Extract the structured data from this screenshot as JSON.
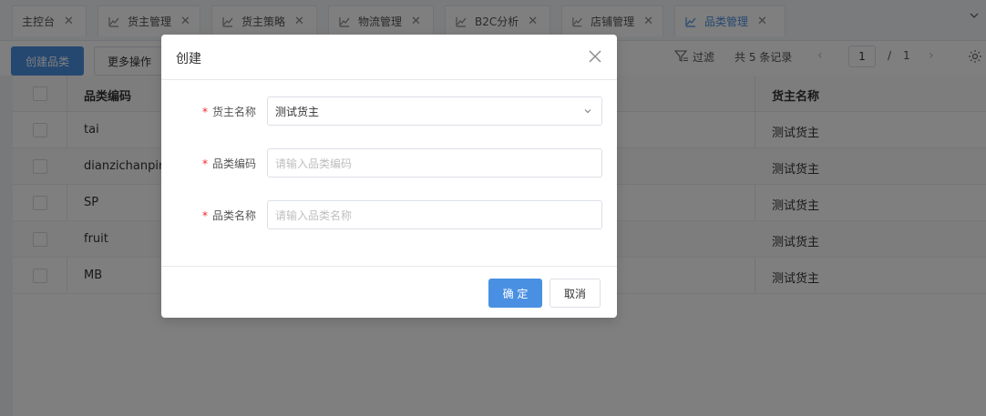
{
  "tabs": [
    {
      "label": "主控台",
      "icon": "none",
      "active": false
    },
    {
      "label": "货主管理",
      "icon": "chart-icon",
      "active": false
    },
    {
      "label": "货主策略",
      "icon": "chart-icon",
      "active": false
    },
    {
      "label": "物流管理",
      "icon": "chart-icon",
      "active": false
    },
    {
      "label": "B2C分析",
      "icon": "chart-icon",
      "active": false
    },
    {
      "label": "店铺管理",
      "icon": "chart-icon",
      "active": false
    },
    {
      "label": "品类管理",
      "icon": "chart-icon",
      "active": true
    }
  ],
  "toolbar": {
    "create_label": "创建品类",
    "more_label": "更多操作",
    "filter_label": "过滤",
    "total_label": "共 5 条记录",
    "page_current": "1",
    "page_sep": "/",
    "page_total": "1"
  },
  "table": {
    "columns": [
      "品类编码",
      "货主名称"
    ],
    "rows": [
      {
        "code": "tai",
        "owner": "测试货主"
      },
      {
        "code": "dianzichanpin",
        "owner": "测试货主"
      },
      {
        "code": "SP",
        "owner": "测试货主"
      },
      {
        "code": "fruit",
        "owner": "测试货主"
      },
      {
        "code": "MB",
        "owner": "测试货主"
      }
    ]
  },
  "modal": {
    "title": "创建",
    "required_mark": "*",
    "fields": [
      {
        "label": "货主名称",
        "value": "测试货主",
        "placeholder": ""
      },
      {
        "label": "品类编码",
        "value": "",
        "placeholder": "请输入品类编码"
      },
      {
        "label": "品类名称",
        "value": "",
        "placeholder": "请输入品类名称"
      }
    ],
    "ok_label": "确 定",
    "cancel_label": "取消"
  },
  "colors": {
    "primary": "#4a90e2",
    "required": "#f5222d",
    "overlay": "rgba(0,0,0,0.5)"
  }
}
